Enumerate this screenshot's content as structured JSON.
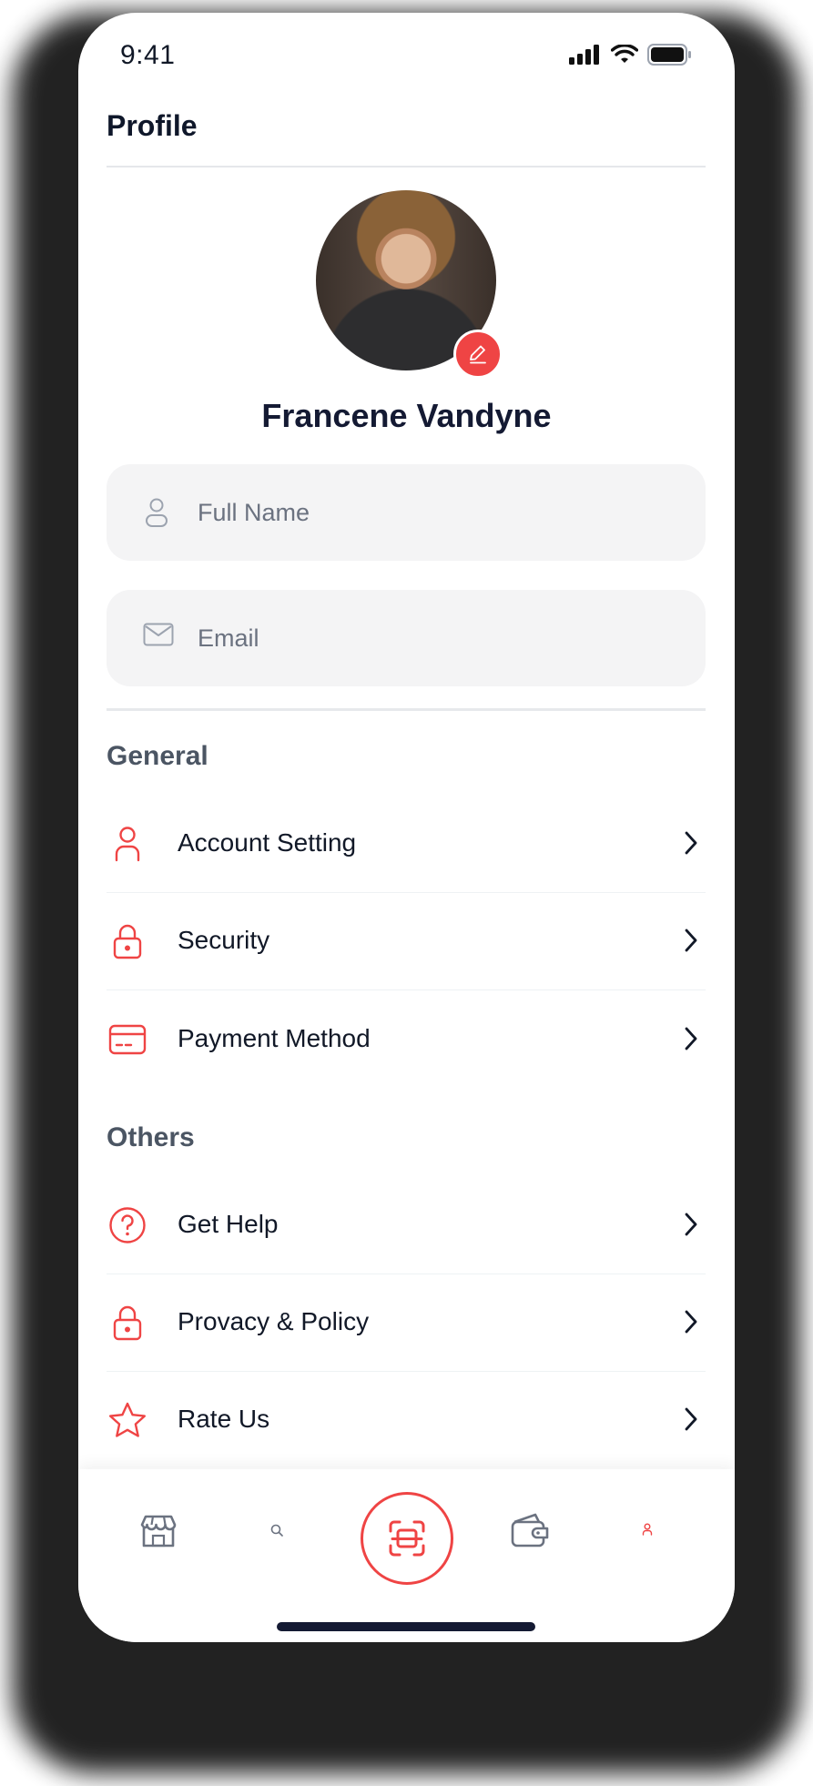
{
  "status_bar": {
    "time": "9:41"
  },
  "header": {
    "title": "Profile"
  },
  "profile": {
    "name": "Francene Vandyne"
  },
  "form": {
    "full_name": {
      "placeholder": "Full Name"
    },
    "email": {
      "placeholder": "Email"
    }
  },
  "general": {
    "title": "General",
    "items": [
      {
        "label": "Account Setting",
        "icon": "user-icon"
      },
      {
        "label": "Security",
        "icon": "lock-icon"
      },
      {
        "label": "Payment Method",
        "icon": "credit-card-icon"
      }
    ]
  },
  "others": {
    "title": "Others",
    "items": [
      {
        "label": "Get Help",
        "icon": "help-circle-icon"
      },
      {
        "label": "Provacy & Policy",
        "icon": "lock-icon"
      },
      {
        "label": "Rate Us",
        "icon": "star-icon"
      }
    ]
  },
  "tab_bar": {
    "items": [
      "store-icon",
      "search-icon",
      "scan-icon",
      "wallet-icon",
      "profile-icon"
    ],
    "active": "profile-icon"
  },
  "colors": {
    "accent": "#ef4444",
    "text": "#111827",
    "field_bg": "#f4f4f5"
  }
}
